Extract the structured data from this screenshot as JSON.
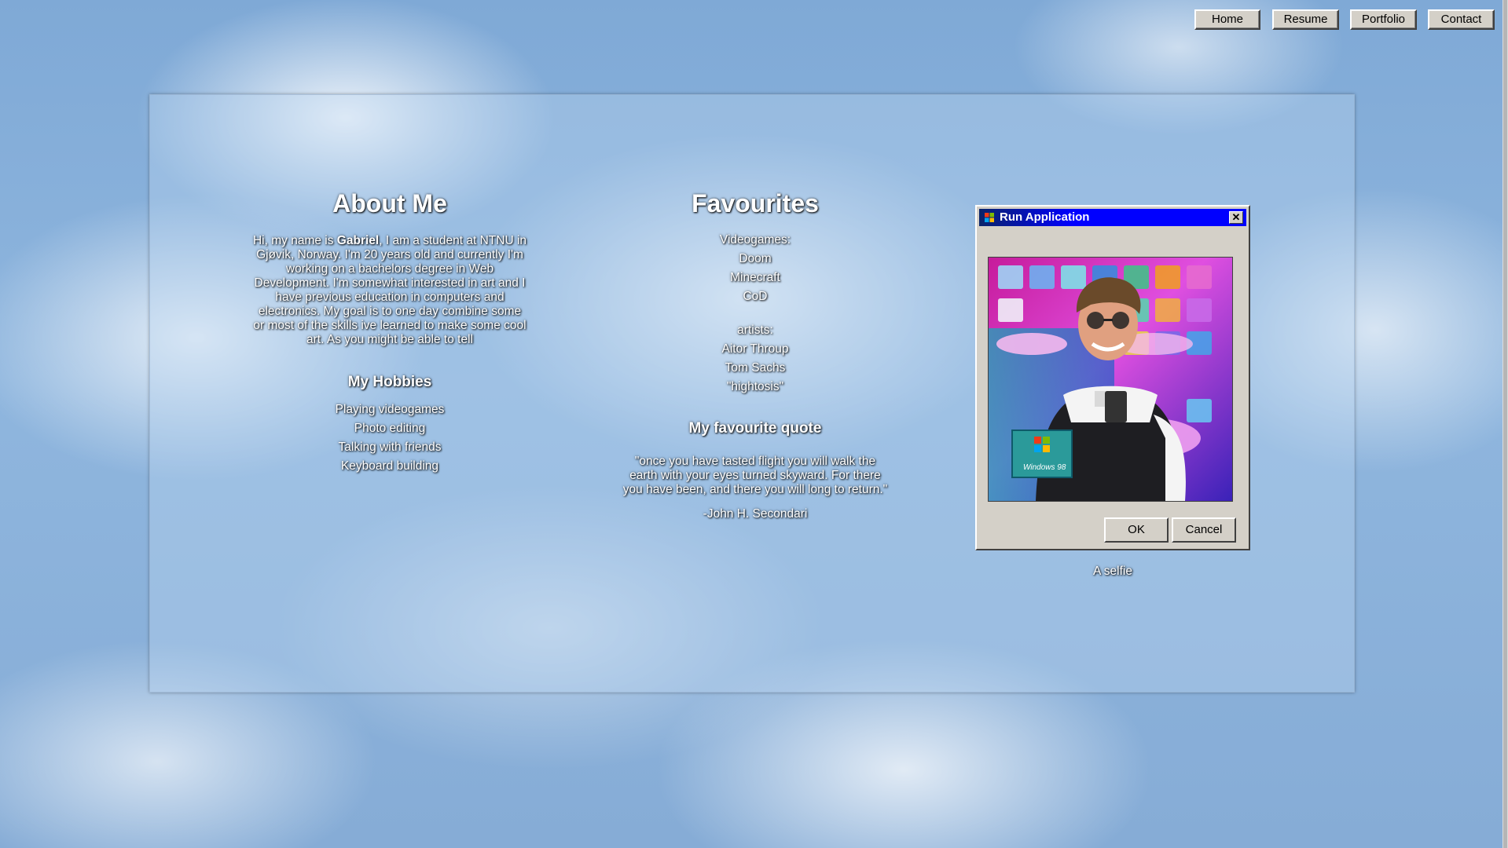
{
  "nav": {
    "items": [
      {
        "label": "Home"
      },
      {
        "label": "Resume"
      },
      {
        "label": "Portfolio"
      },
      {
        "label": "Contact"
      }
    ]
  },
  "about": {
    "title": "About Me",
    "intro_before": "Hi, my name is ",
    "name": "Gabriel",
    "intro_after": ", I am a student at NTNU in Gjøvik, Norway. I'm 20 years old and currently I'm working on a bachelors degree in Web Development. I'm somewhat interested in art and I have previous education in computers and electronics. My goal is to one day combine some or most of the skills ive learned to make some cool art. As you might be able to tell",
    "hobbies_title": "My Hobbies",
    "hobbies": [
      "Playing videogames",
      "Photo editing",
      "Talking with friends",
      "Keyboard building"
    ]
  },
  "favourites": {
    "title": "Favourites",
    "games_heading": "Videogames:",
    "games": [
      "Doom",
      "Minecraft",
      "CoD"
    ],
    "artists_heading": "artists:",
    "artists": [
      "Aitor Throup",
      "Tom Sachs",
      "\"hightosis\""
    ],
    "quote_title": "My favourite quote",
    "quote": "\"once you have tasted flight you will walk the earth with your eyes turned skyward. For there you have been, and there you will long to return.\"",
    "quote_author": "-John H. Secondari"
  },
  "dialog": {
    "title": "Run Application",
    "ok_label": "OK",
    "cancel_label": "Cancel",
    "close_glyph": "✕",
    "photo_badge": "Windows 98",
    "caption": "A selfie"
  },
  "colors": {
    "win_face": "#d4d0c8",
    "title_bar": "#0000ff",
    "sky": "#8fb6de"
  }
}
